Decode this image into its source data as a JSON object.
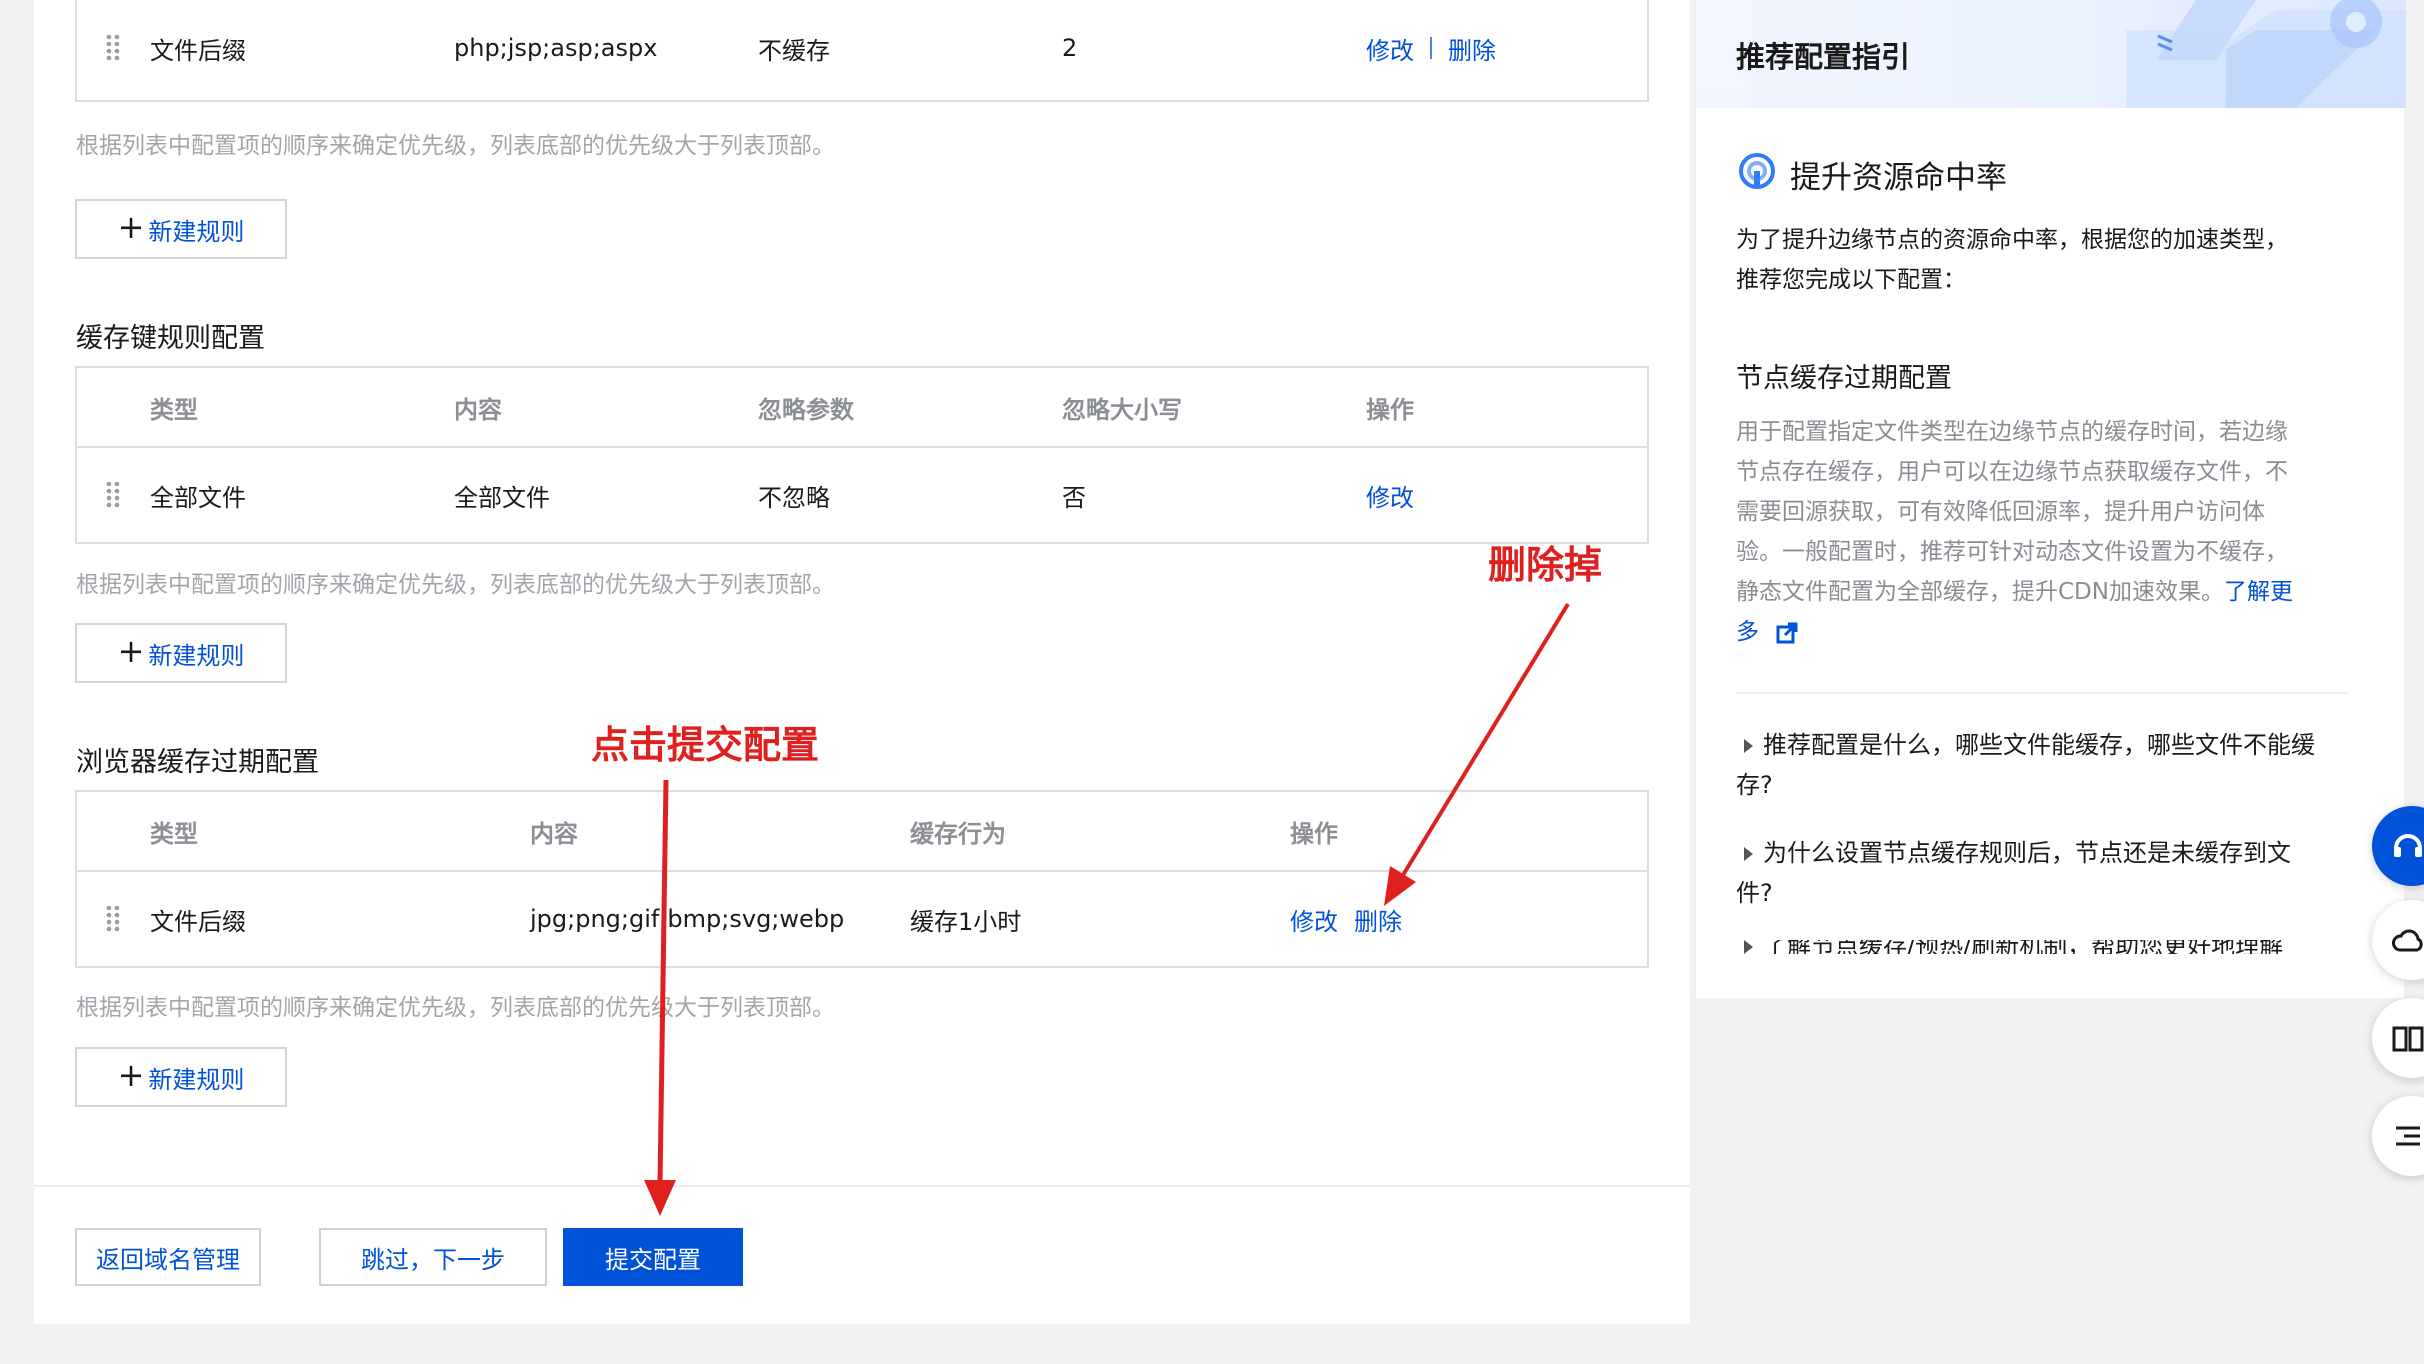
{
  "table1": {
    "row": {
      "type": "文件后缀",
      "content": "php;jsp;asp;aspx",
      "behavior": "不缓存",
      "priority": "2",
      "edit": "修改",
      "delete": "删除"
    }
  },
  "note_text": "根据列表中配置项的顺序来确定优先级，列表底部的优先级大于列表顶部。",
  "new_rule": "新建规则",
  "cache_key": {
    "title": "缓存键规则配置",
    "headers": [
      "类型",
      "内容",
      "忽略参数",
      "忽略大小写",
      "操作"
    ],
    "row": {
      "type": "全部文件",
      "content": "全部文件",
      "ignore_params": "不忽略",
      "ignore_case": "否",
      "edit": "修改"
    }
  },
  "browser_cache": {
    "title": "浏览器缓存过期配置",
    "headers": [
      "类型",
      "内容",
      "缓存行为",
      "操作"
    ],
    "row": {
      "type": "文件后缀",
      "content": "jpg;png;gif;bmp;svg;webp",
      "behavior": "缓存1小时",
      "edit": "修改",
      "delete": "删除"
    }
  },
  "footer": {
    "back": "返回域名管理",
    "skip": "跳过，下一步",
    "submit": "提交配置"
  },
  "guide": {
    "title": "推荐配置指引",
    "subtitle": "提升资源命中率",
    "intro_1": "为了提升边缘节点的资源命中率，根据您的加速类型，",
    "intro_2": "推荐您完成以下配置：",
    "section_title": "节点缓存过期配置",
    "desc_lines": [
      "用于配置指定文件类型在边缘节点的缓存时间，若边缘",
      "节点存在缓存，用户可以在边缘节点获取缓存文件，不",
      "需要回源获取，可有效降低回源率，提升用户访问体",
      "验。一般配置时，推荐可针对动态文件设置为不缓存，",
      "静态文件配置为全部缓存，提升CDN加速效果。"
    ],
    "learn_more_1": "了解更",
    "learn_more_2": "多",
    "faq": [
      {
        "line1": "推荐配置是什么，哪些文件能缓存，哪些文件不能缓",
        "line2": "存?"
      },
      {
        "line1": "为什么设置节点缓存规则后，节点还是未缓存到文",
        "line2": "件?"
      },
      {
        "line1": "了解节点缓存/预热/刷新机制，帮助您更好地理解",
        "line2": ""
      }
    ]
  },
  "annotations": {
    "delete_label": "删除掉",
    "submit_label": "点击提交配置"
  },
  "colors": {
    "accent": "#0052d9",
    "annotation": "#e0201f"
  }
}
